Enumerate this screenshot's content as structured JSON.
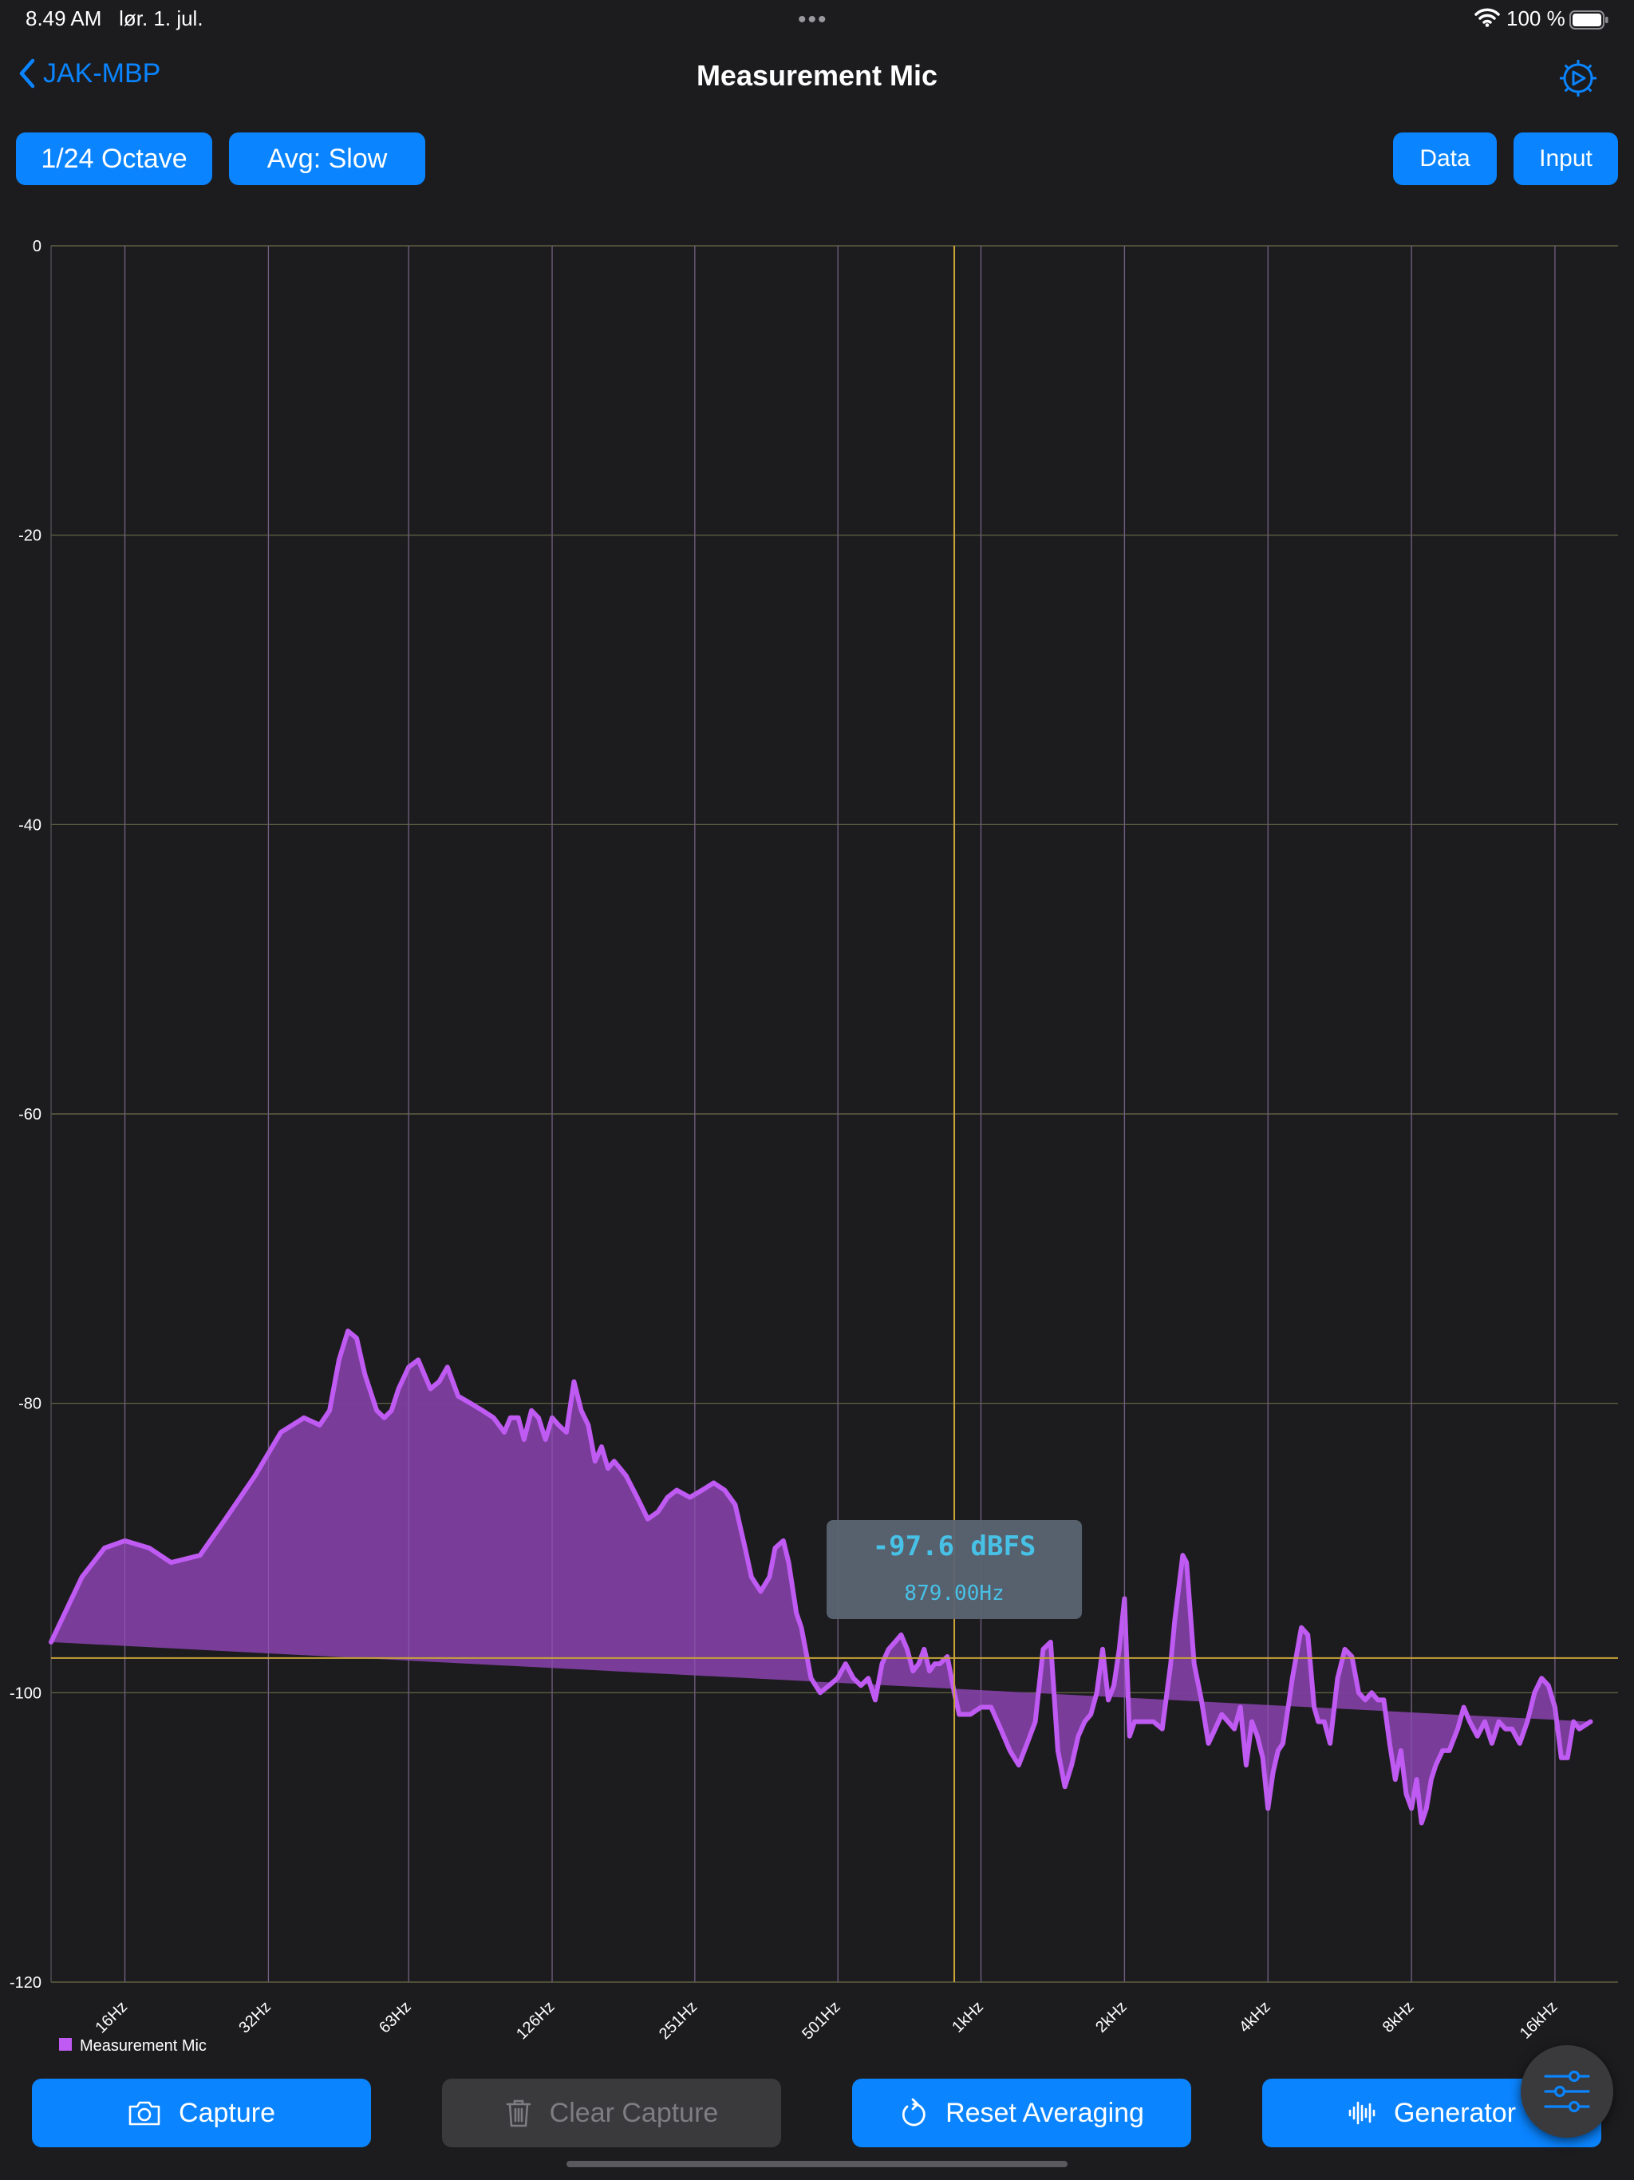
{
  "status_bar": {
    "time": "8.49 AM",
    "date": "lør. 1. jul.",
    "dots": "•••",
    "battery": "100 %"
  },
  "nav": {
    "back_label": "JAK-MBP",
    "title": "Measurement Mic"
  },
  "toolbar": {
    "octave_label": "1/24 Octave",
    "avg_label": "Avg: Slow",
    "data_label": "Data",
    "input_label": "Input"
  },
  "cursor": {
    "value_label": "-97.6 dBFS",
    "freq_label": "879.00Hz",
    "freq_hz": 879,
    "level_db": -97.6
  },
  "chart_data": {
    "type": "area",
    "x_scale": "log",
    "xlim_hz": [
      11.2,
      21700
    ],
    "ylim": [
      -120,
      0
    ],
    "ytick_labels": [
      "0",
      "-20",
      "-40",
      "-60",
      "-80",
      "-100",
      "-120"
    ],
    "yticks": [
      0,
      -20,
      -40,
      -60,
      -80,
      -100,
      -120
    ],
    "xtick_labels": [
      "16Hz",
      "32Hz",
      "63Hz",
      "126Hz",
      "251Hz",
      "501Hz",
      "1kHz",
      "2kHz",
      "4kHz",
      "8kHz",
      "16kHz"
    ],
    "xticks_hz": [
      16,
      32,
      63,
      126,
      251,
      501,
      1000,
      2000,
      4000,
      8000,
      16000
    ],
    "grid": true,
    "legend_position": "bottom-left",
    "series": [
      {
        "name": "Measurement Mic",
        "color": "#bf5af2",
        "fill": "#7e3fa0",
        "x_hz": [
          11.2,
          13,
          14.5,
          16,
          18,
          20,
          23,
          26,
          30,
          34,
          38,
          41,
          43,
          45,
          47,
          49,
          51,
          54,
          56,
          58,
          60,
          63,
          66,
          70,
          73,
          76,
          80,
          85,
          90,
          95,
          100,
          103,
          107,
          110,
          114,
          118,
          122,
          126,
          130,
          135,
          140,
          145,
          150,
          155,
          160,
          165,
          170,
          175,
          180,
          190,
          200,
          210,
          215,
          220,
          230,
          245,
          260,
          275,
          290,
          305,
          320,
          330,
          345,
          360,
          370,
          385,
          395,
          410,
          420,
          440,
          460,
          480,
          500,
          520,
          540,
          560,
          580,
          600,
          620,
          640,
          660,
          680,
          700,
          720,
          740,
          760,
          780,
          800,
          820,
          850,
          879,
          900,
          950,
          1000,
          1050,
          1100,
          1150,
          1200,
          1250,
          1300,
          1350,
          1400,
          1450,
          1500,
          1550,
          1600,
          1650,
          1700,
          1750,
          1800,
          1850,
          1900,
          1950,
          2000,
          2050,
          2100,
          2200,
          2300,
          2400,
          2500,
          2550,
          2650,
          2700,
          2800,
          2900,
          3000,
          3100,
          3200,
          3300,
          3400,
          3500,
          3600,
          3700,
          3800,
          3900,
          4000,
          4100,
          4200,
          4300,
          4500,
          4700,
          4850,
          5000,
          5100,
          5250,
          5400,
          5600,
          5800,
          6000,
          6200,
          6400,
          6600,
          6800,
          7000,
          7200,
          7400,
          7600,
          7800,
          8000,
          8200,
          8400,
          8600,
          8800,
          9000,
          9300,
          9600,
          10000,
          10300,
          10600,
          11000,
          11400,
          11800,
          12200,
          12600,
          13000,
          13500,
          14000,
          14500,
          15000,
          15500,
          16000,
          16500,
          17000,
          17500,
          18000,
          19000,
          20000,
          20500,
          21000,
          21700
        ],
        "values": [
          -96.5,
          -92,
          -90,
          -89.5,
          -90,
          -91,
          -90.5,
          -88,
          -85,
          -82,
          -81,
          -81.5,
          -80.5,
          -77,
          -75,
          -75.5,
          -78,
          -80.5,
          -81,
          -80.5,
          -79,
          -77.5,
          -77,
          -79,
          -78.5,
          -77.5,
          -79.5,
          -80,
          -80.5,
          -81,
          -82,
          -81,
          -81,
          -82.5,
          -80.5,
          -81,
          -82.5,
          -81,
          -81.5,
          -82,
          -78.5,
          -80.5,
          -81.5,
          -84,
          -83,
          -84.5,
          -84,
          -84.5,
          -85,
          -86.5,
          -88,
          -87.5,
          -87,
          -86.5,
          -86,
          -86.5,
          -86,
          -85.5,
          -86,
          -87,
          -90,
          -92,
          -93,
          -92,
          -90,
          -89.5,
          -91,
          -94.5,
          -95.5,
          -99,
          -100,
          -99.5,
          -99,
          -98,
          -99,
          -99.5,
          -99,
          -100.5,
          -98,
          -97,
          -96.5,
          -96,
          -97,
          -98.5,
          -98,
          -97,
          -98.5,
          -98,
          -98,
          -97.5,
          -100,
          -101.5,
          -101.5,
          -101,
          -101,
          -102.5,
          -104,
          -105,
          -103.5,
          -102,
          -97,
          -96.5,
          -104,
          -106.5,
          -105,
          -103,
          -102,
          -101.5,
          -100,
          -97,
          -100.5,
          -99.5,
          -97,
          -93.5,
          -103,
          -102,
          -102,
          -102,
          -102.5,
          -98,
          -95,
          -90.5,
          -91,
          -98,
          -100.5,
          -103.5,
          -102.5,
          -101.5,
          -102,
          -102.5,
          -101,
          -105,
          -102,
          -103,
          -104.5,
          -108,
          -105.5,
          -104,
          -103.5,
          -99,
          -95.5,
          -96,
          -101,
          -102,
          -102,
          -103.5,
          -99,
          -97,
          -97.5,
          -100,
          -100.5,
          -100,
          -100.5,
          -100.5,
          -103.5,
          -106,
          -104,
          -107,
          -108,
          -106,
          -109,
          -108,
          -106,
          -105,
          -104,
          -104,
          -102.5,
          -101,
          -102,
          -103,
          -102,
          -103.5,
          -102,
          -102.5,
          -102.5,
          -103.5,
          -102,
          -100,
          -99,
          -99.5,
          -101,
          -104.5,
          -104.5,
          -102,
          -102.5,
          -102
        ]
      }
    ]
  },
  "bottom_bar": {
    "capture_label": "Capture",
    "clear_capture_label": "Clear Capture",
    "reset_averaging_label": "Reset Averaging",
    "generator_label": "Generator"
  },
  "colors": {
    "accent": "#0a84ff",
    "background": "#1c1c1e",
    "series": "#bf5af2",
    "cursor_line": "#c9a33a",
    "tooltip_bg": "#5b6472",
    "tooltip_text": "#48c1e6"
  },
  "icons": {
    "back": "chevron-left-icon",
    "settings": "gear-icon",
    "capture": "camera-icon",
    "clear": "trash-icon",
    "reset": "rotate-ccw-icon",
    "generator": "waveform-icon",
    "fab": "sliders-icon"
  }
}
